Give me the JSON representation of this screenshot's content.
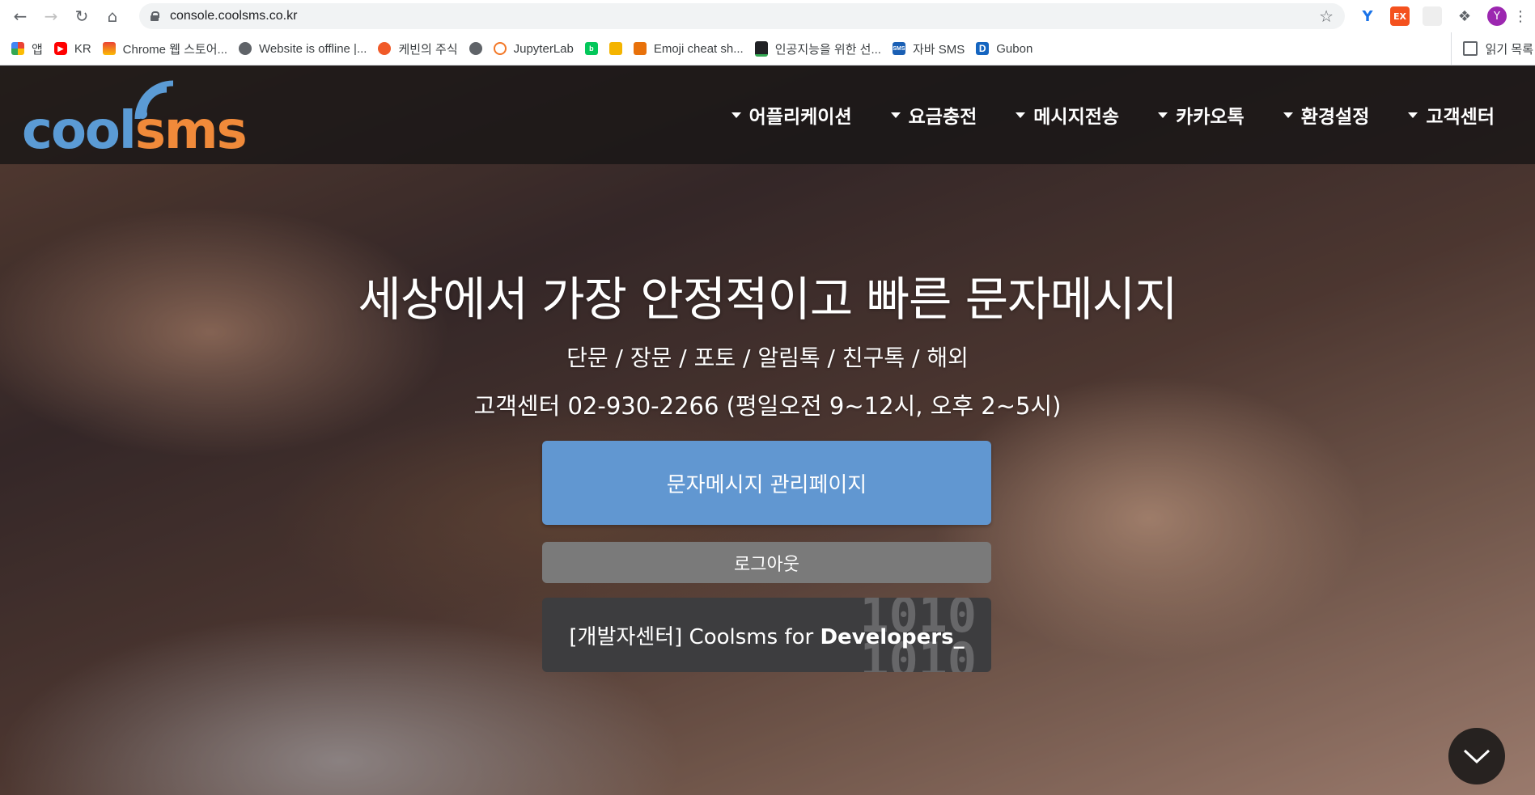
{
  "browser": {
    "url": "console.coolsms.co.kr",
    "bookmarks": [
      {
        "label": "앱",
        "icon": "apps-grid-icon",
        "color": "#e8453c"
      },
      {
        "label": "KR",
        "icon": "youtube-icon",
        "color": "#ff0000"
      },
      {
        "label": "Chrome 웹 스토어...",
        "icon": "chrome-webstore-icon",
        "color": "#4285f4"
      },
      {
        "label": "Website is offline |...",
        "icon": "globe-icon",
        "color": "#5f6368"
      },
      {
        "label": "케빈의 주식",
        "icon": "kevin-stock-icon",
        "color": "#f05a28"
      },
      {
        "label": "",
        "icon": "globe-icon",
        "color": "#5f6368"
      },
      {
        "label": "JupyterLab",
        "icon": "jupyter-icon",
        "color": "#f37726"
      },
      {
        "label": "",
        "icon": "naver-blog-icon",
        "color": "#03c75a"
      },
      {
        "label": "",
        "icon": "thumbs-up-icon",
        "color": "#f4b400"
      },
      {
        "label": "Emoji cheat sh...",
        "icon": "gift-icon",
        "color": "#e8710a"
      },
      {
        "label": "인공지능을 위한 선...",
        "icon": "terminal-icon",
        "color": "#202124"
      },
      {
        "label": "자바 SMS",
        "icon": "sms-icon",
        "color": "#1a5fb4"
      },
      {
        "label": "Gubon",
        "icon": "d-logo-icon",
        "color": "#1565c0"
      }
    ],
    "reading_list": "읽기 목록"
  },
  "site": {
    "logo_cool": "cool",
    "logo_sms": "sms",
    "menu": [
      "어플리케이션",
      "요금충전",
      "메시지전송",
      "카카오톡",
      "환경설정",
      "고객센터"
    ]
  },
  "hero": {
    "title": "세상에서 가장 안정적이고 빠른 문자메시지",
    "subtitle": "단문 / 장문 / 포토 / 알림톡 / 친구톡 / 해외",
    "contact": "고객센터 02-930-2266 (평일오전 9~12시, 오후 2~5시)"
  },
  "buttons": {
    "manage": "문자메시지 관리페이지",
    "logout": "로그아웃",
    "dev_prefix": "[개발자센터] Coolsms for ",
    "dev_bold": "Developers_",
    "dev_bg_top": "1010",
    "dev_bg_bottom": "1010"
  },
  "colors": {
    "logo_blue": "#5b9bd5",
    "logo_orange": "#f08a3a",
    "primary_button": "#6197d1",
    "logout_button": "#7a7a7a",
    "dev_button": "#3d3d3f"
  }
}
